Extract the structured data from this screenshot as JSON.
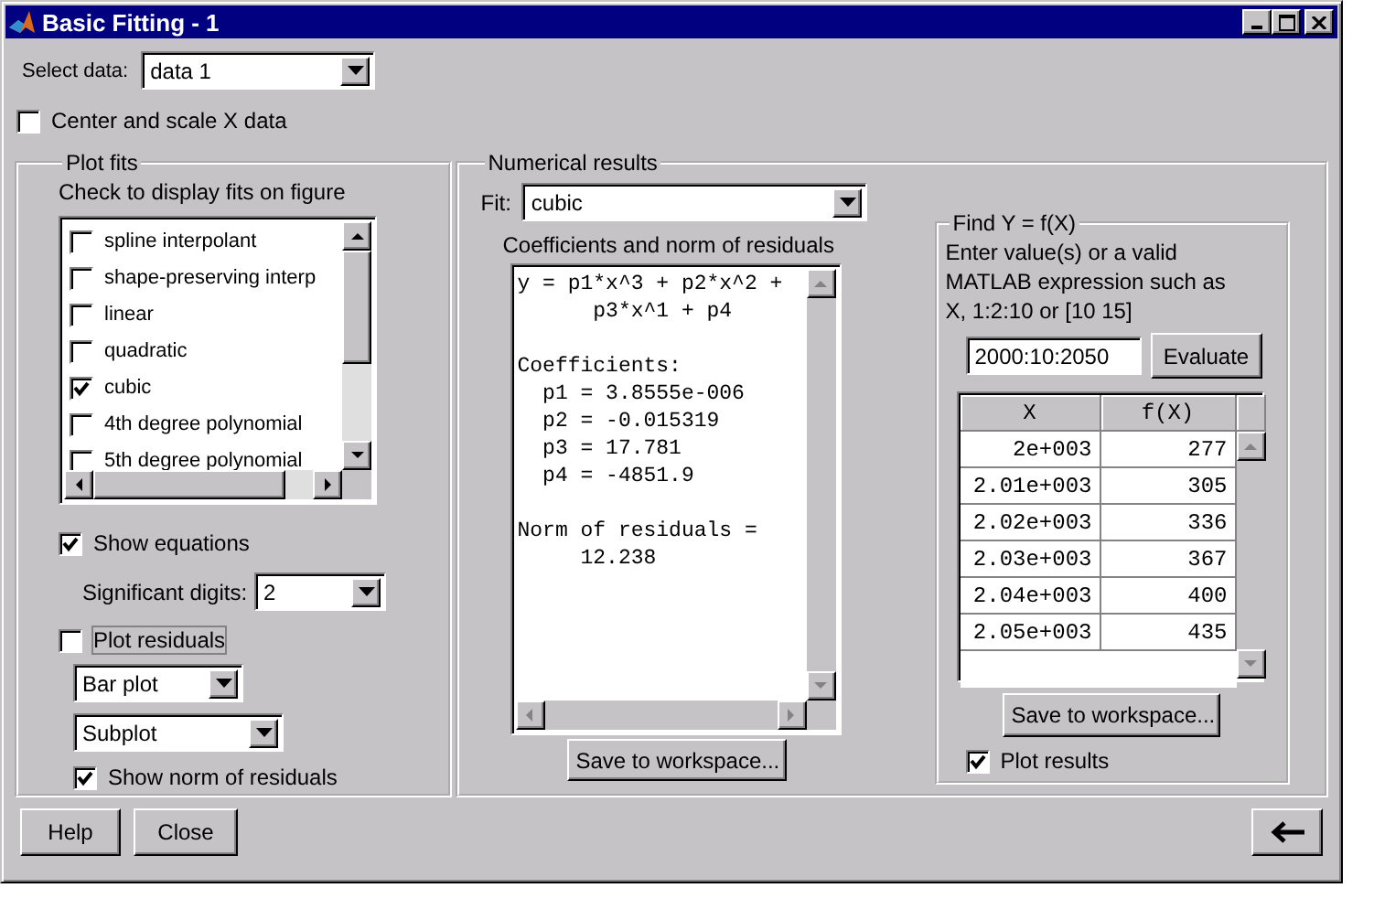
{
  "window": {
    "title": "Basic Fitting - 1"
  },
  "select_data": {
    "label": "Select data:",
    "value": "data 1"
  },
  "center_scale": {
    "label": "Center and scale X data",
    "checked": false
  },
  "plot_fits": {
    "title": "Plot fits",
    "instruction": "Check to display fits on figure",
    "fits": [
      {
        "label": "spline interpolant",
        "checked": false
      },
      {
        "label": "shape-preserving interp",
        "checked": false
      },
      {
        "label": "linear",
        "checked": false
      },
      {
        "label": "quadratic",
        "checked": false
      },
      {
        "label": "cubic",
        "checked": true
      },
      {
        "label": "4th degree polynomial",
        "checked": false
      },
      {
        "label": "5th degree polynomial",
        "checked": false
      }
    ],
    "show_equations": {
      "label": "Show equations",
      "checked": true
    },
    "significant_digits": {
      "label": "Significant digits:",
      "value": "2"
    },
    "plot_residuals": {
      "label": "Plot residuals",
      "checked": false,
      "focused": true
    },
    "residual_plot_type": {
      "value": "Bar plot"
    },
    "residual_location": {
      "value": "Subplot"
    },
    "show_norm": {
      "label": "Show norm of residuals",
      "checked": true
    }
  },
  "numerical_results": {
    "title": "Numerical results",
    "fit": {
      "label": "Fit:",
      "value": "cubic"
    },
    "coefficients_label": "Coefficients and norm of residuals",
    "results": [
      {
        "lines": [
          "y = p1*x^3 + p2*x^2 +",
          "      p3*x^1 + p4"
        ]
      },
      {
        "lines": [
          "Coefficients:",
          "  p1 = 3.8555e-006",
          "  p2 = -0.015319",
          "  p3 = 17.781",
          "  p4 = -4851.9"
        ]
      },
      {
        "lines": [
          "Norm of residuals =",
          "     12.238"
        ]
      }
    ],
    "save_button": "Save to workspace..."
  },
  "find_y": {
    "title": "Find Y = f(X)",
    "instruction": "Enter value(s) or a valid MATLAB expression such as X, 1:2:10 or [10 15]",
    "input": {
      "value": "2000:10:2050"
    },
    "evaluate_button": "Evaluate",
    "table": {
      "columns": [
        "X",
        "f(X)"
      ],
      "rows": [
        [
          "2e+003",
          "277"
        ],
        [
          "2.01e+003",
          "305"
        ],
        [
          "2.02e+003",
          "336"
        ],
        [
          "2.03e+003",
          "367"
        ],
        [
          "2.04e+003",
          "400"
        ],
        [
          "2.05e+003",
          "435"
        ]
      ]
    },
    "save_button": "Save to workspace...",
    "plot_results": {
      "label": "Plot results",
      "checked": true
    }
  },
  "buttons": [
    "Help",
    "Close"
  ]
}
